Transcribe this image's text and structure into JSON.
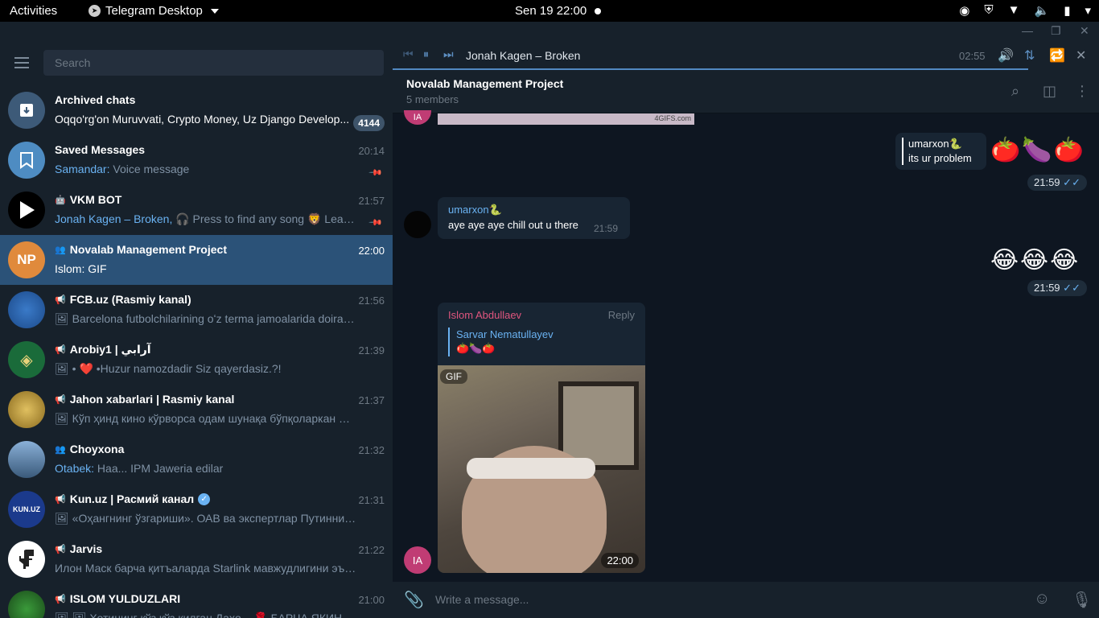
{
  "system_bar": {
    "activities": "Activities",
    "app_name": "Telegram Desktop",
    "clock": "Sen 19  22:00"
  },
  "sidebar": {
    "search_placeholder": "Search",
    "chats": [
      {
        "name": "Archived chats",
        "time": "",
        "preview": "Oqqo'rg'on Muruvvati, Crypto Money, Uz Django Develop...",
        "badge": "4144",
        "avatar_color": "#3d5a78",
        "avatar_icon": "archive-icon"
      },
      {
        "name": "Saved Messages",
        "time": "20:14",
        "sender": "Samandar:",
        "preview": " Voice message",
        "avatar_color": "#4e8cc2",
        "avatar_icon": "bookmark-icon",
        "pinned": true
      },
      {
        "name": "VKM BOT",
        "time": "21:57",
        "sender": "Jonah Kagen – Broken,",
        "preview": " 🎧 Press to find any song 🦁 Learn R...",
        "avatar_color": "#000000",
        "avatar_icon": "play-icon",
        "pinned": true
      },
      {
        "name": "Novalab Management Project",
        "time": "22:00",
        "preview": "Islom: GIF",
        "avatar_text": "NP",
        "avatar_color": "#e08a3c"
      },
      {
        "name": "FCB.uz (Rasmiy kanal)",
        "time": "21:56",
        "preview": "🖼 Barcelona  futbolchilarining oʻz terma jamoalarida doirasida ...",
        "avatar_color": "#1c4a8a"
      },
      {
        "name": "Arobiy1 | آرابي",
        "time": "21:39",
        "preview": "🖼 • ❤️ •Huzur namozdadir  Siz qayerdasiz.?!",
        "avatar_color": "#1a6b3a"
      },
      {
        "name": "Jahon xabarlari | Rasmiy kanal",
        "time": "21:37",
        "preview": "🖼 Кўп ҳинд кино кўрворса одам шунақа бўпқоларкан 😅 Лек...",
        "avatar_color": "#b8962e"
      },
      {
        "name": "Choyxona",
        "time": "21:32",
        "sender": "Otabek:",
        "preview": " Haa... IPM Jaweria edilar",
        "avatar_color": "#4a6a8a"
      },
      {
        "name": "Kun.uz | Расмий канал",
        "time": "21:31",
        "preview": "🖼 «Оҳангнинг ўзгариши». ОАВ ва экспертлар Путиннинг ШҲТ...",
        "avatar_text": "KUN.UZ",
        "avatar_color": "#1b3a8c",
        "verified": true
      },
      {
        "name": "Jarvis",
        "time": "21:22",
        "preview": "Илон Маск барча қитъаларда Starlink мавжудлигини эълон қи...",
        "avatar_color": "#ffffff"
      },
      {
        "name": "ISLOM YULDUZLARI",
        "time": "21:00",
        "preview": "🖼 🖼 Хотининг кўз кўз қилган Даҳо... 🌹 БАРЧА ЯКИНЛАРИНГ",
        "avatar_color": "#2a6a2a"
      }
    ]
  },
  "player": {
    "track": "Jonah Kagen – Broken",
    "time": "02:55"
  },
  "chat_header": {
    "title": "Novalab Management Project",
    "members": "5 members"
  },
  "messages": {
    "gif_watermark": "4GIFS.com",
    "top_avatar_initials": "IA",
    "out1": {
      "reply_name": "umarxon🐍",
      "reply_text": "its ur problem",
      "emojis": "🍅🍆🍅",
      "time": "21:59"
    },
    "in1": {
      "sender": "umarxon🐍",
      "text": "aye aye aye chill out u there",
      "time": "21:59"
    },
    "out2": {
      "emojis": "😂😂😂",
      "time": "21:59"
    },
    "in2": {
      "sender": "Islom Abdullaev",
      "reply_action": "Reply",
      "reply_name": "Sarvar Nematullayev",
      "reply_text": "🍅🍆🍅",
      "gif_label": "GIF",
      "time": "22:00",
      "avatar_initials": "IA"
    }
  },
  "composer": {
    "placeholder": "Write a message..."
  },
  "colors": {
    "accent": "#5288c1",
    "active_chat": "#2b5278",
    "sidebar_bg": "#17212b",
    "chat_bg": "#0e1621"
  }
}
